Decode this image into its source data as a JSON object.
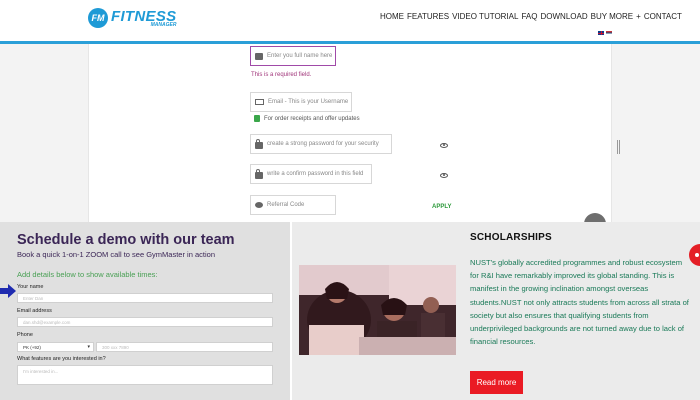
{
  "brand": {
    "logo_badge": "FM",
    "logo_main": "FITNESS",
    "logo_sub": "MANAGER",
    "accent": "#1e9ad6"
  },
  "nav": {
    "items": [
      "HOME",
      "FEATURES",
      "VIDEO TUTORIAL",
      "FAQ",
      "DOWNLOAD",
      "BUY MORE",
      "+",
      "CONTACT"
    ]
  },
  "signup_form": {
    "name_placeholder": "Enter you full name here",
    "required_msg": "This is a required field.",
    "email_placeholder": "Email - This is your Username",
    "email_hint": "For order receipts and offer updates",
    "password_placeholder": "create a strong password for your security",
    "confirm_placeholder": "write a confirm password in this field",
    "referral_placeholder": "Referral Code",
    "apply_label": "APPLY"
  },
  "demo": {
    "title": "Schedule a demo with our team",
    "subtitle": "Book a quick 1-on-1 ZOOM call to see GymMaster in action",
    "add_details": "Add details below to show available times:",
    "name_label": "Your name",
    "name_placeholder": "Enter Dan",
    "email_label": "Email address",
    "email_placeholder": "dan.shd@example.com",
    "phone_label": "Phone",
    "country_value": "PK (+92)",
    "phone_placeholder": "300 xxx 7890",
    "features_label": "What features are you interested in?",
    "features_placeholder": "I'm interested in..."
  },
  "scholarships": {
    "title": "SCHOLARSHIPS",
    "body": "NUST's globally accredited programmes and robust ecosystem for R&I have remarkably improved its global standing. This is manifest in the growing inclination amongst overseas students.NUST not only attracts students from across all strata of society but also ensures that qualifying students from underprivileged backgrounds are not turned away due to lack of financial resources.",
    "read_more": "Read more",
    "button_color": "#ea1b24",
    "text_color": "#1a7a58"
  }
}
